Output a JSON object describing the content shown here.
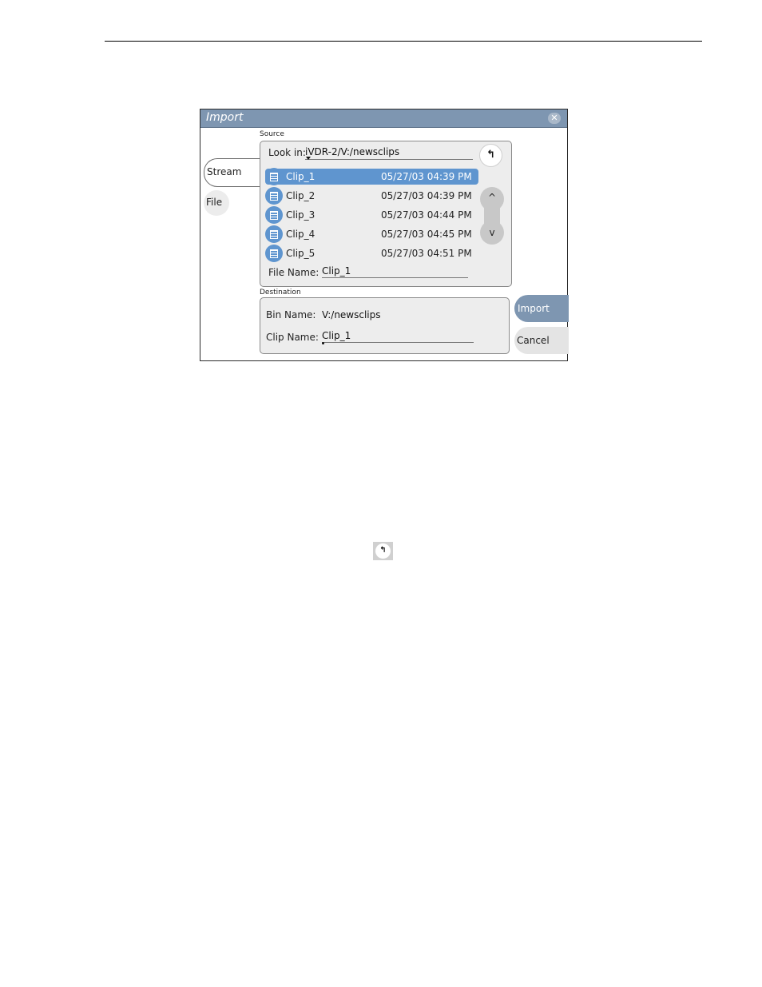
{
  "dialog": {
    "title": "Import",
    "close_glyph": "✕"
  },
  "tabs": [
    {
      "label": "Stream",
      "selected": true
    },
    {
      "label": "File",
      "selected": false
    }
  ],
  "source": {
    "group_label": "Source",
    "look_in_label": "Look in:",
    "look_in_value": "iVDR-2/V:/newsclips",
    "up_icon": "up-folder-icon",
    "up_glyph": "↰",
    "clips": [
      {
        "name": "Clip_1",
        "date": "05/27/03 04:39 PM",
        "selected": true
      },
      {
        "name": "Clip_2",
        "date": "05/27/03 04:39 PM",
        "selected": false
      },
      {
        "name": "Clip_3",
        "date": "05/27/03 04:44 PM",
        "selected": false
      },
      {
        "name": "Clip_4",
        "date": "05/27/03 04:45 PM",
        "selected": false
      },
      {
        "name": "Clip_5",
        "date": "05/27/03 04:51 PM",
        "selected": false
      }
    ],
    "file_name_label": "File Name:",
    "file_name_value": "Clip_1",
    "scroll_up_glyph": "^",
    "scroll_down_glyph": "v"
  },
  "destination": {
    "group_label": "Destination",
    "bin_name_label": "Bin Name:",
    "bin_name_value": "V:/newsclips",
    "clip_name_label": "Clip Name:",
    "clip_name_value": "Clip_1"
  },
  "buttons": {
    "import_label": "Import",
    "cancel_label": "Cancel"
  },
  "colors": {
    "title_bar": "#7e96b1",
    "selection": "#5f95cf",
    "panel": "#ededed"
  }
}
